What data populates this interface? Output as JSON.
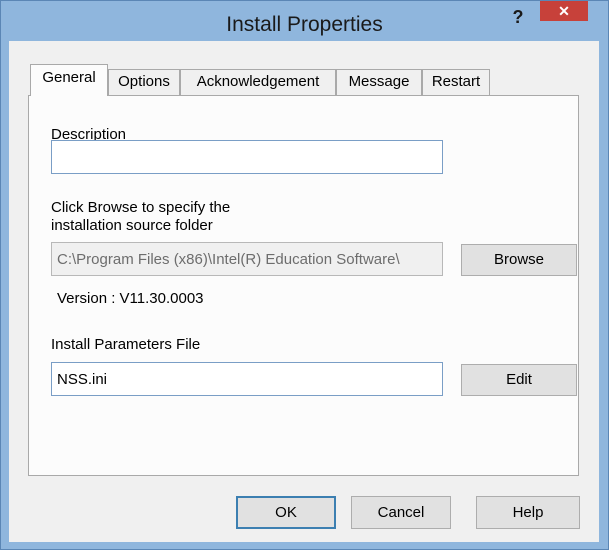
{
  "window": {
    "title": "Install Properties",
    "help_glyph": "?",
    "close_glyph": "✕"
  },
  "tabs": [
    {
      "label": "General",
      "active": true
    },
    {
      "label": "Options",
      "active": false
    },
    {
      "label": "Acknowledgement",
      "active": false
    },
    {
      "label": "Message",
      "active": false
    },
    {
      "label": "Restart",
      "active": false
    }
  ],
  "general": {
    "description_label": "Description",
    "description_value": "",
    "browse_hint_line1": "Click Browse to specify the",
    "browse_hint_line2": "installation source folder",
    "source_folder_value": "C:\\Program Files (x86)\\Intel(R) Education Software\\",
    "browse_button": "Browse",
    "version_text": "Version : V11.30.0003",
    "params_label": "Install Parameters File",
    "params_value": "NSS.ini",
    "edit_button": "Edit"
  },
  "footer": {
    "ok_button": "OK",
    "cancel_button": "Cancel",
    "help_button": "Help"
  },
  "colors": {
    "frame": "#8fb6dd",
    "close_button": "#c7413a",
    "dialog_bg": "#f0f0f0"
  }
}
